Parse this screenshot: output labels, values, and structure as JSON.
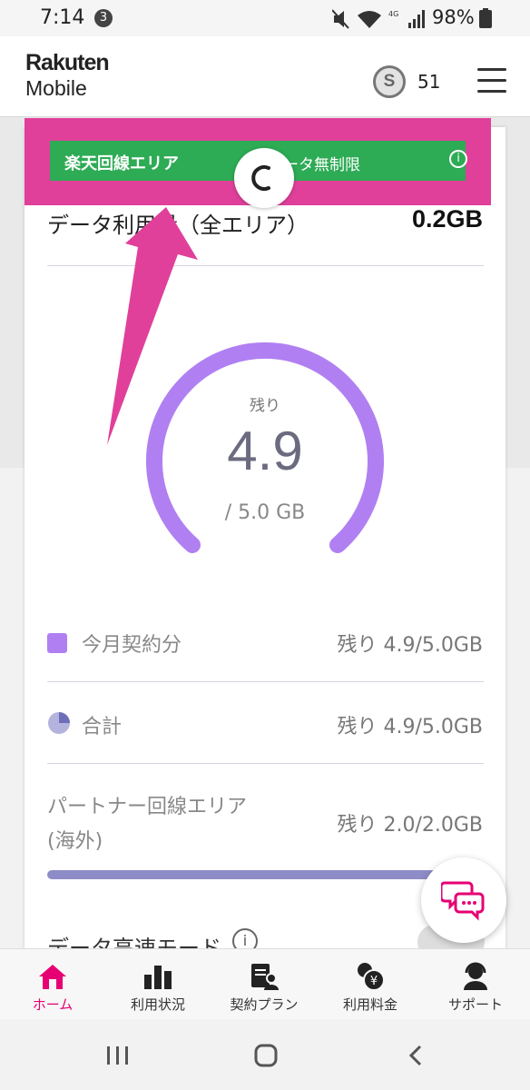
{
  "status_bar": {
    "time": "7:14",
    "notification_count": "3",
    "network": "4G",
    "battery": "98%"
  },
  "header": {
    "logo_line1": "Rakuten",
    "logo_line2": "Mobile",
    "points_icon_letter": "S",
    "points_count": "51"
  },
  "banner": {
    "area_label": "楽天回線エリア",
    "plan_label": "データ無制限",
    "highlight_color": "#e0409a",
    "banner_color": "#2dab55"
  },
  "usage": {
    "label": "データ利用量（全エリア）",
    "value": "0.2GB"
  },
  "gauge": {
    "remaining_label": "残り",
    "remaining_value": "4.9",
    "total": "/ 5.0 GB",
    "remaining_fraction": 0.98,
    "color": "#b080f2"
  },
  "breakdown": [
    {
      "label": "今月契約分",
      "value": "残り 4.9/5.0GB"
    },
    {
      "label": "合計",
      "value": "残り 4.9/5.0GB"
    },
    {
      "label_line1": "パートナー回線エリア",
      "label_line2": "(海外)",
      "value": "残り 2.0/2.0GB"
    }
  ],
  "fast_mode": {
    "label": "データ高速モード"
  },
  "bottom_nav": [
    {
      "label": "ホーム",
      "icon": "home-icon",
      "active": true
    },
    {
      "label": "利用状況",
      "icon": "bar-chart-icon"
    },
    {
      "label": "契約プラン",
      "icon": "contract-icon"
    },
    {
      "label": "利用料金",
      "icon": "yen-coins-icon"
    },
    {
      "label": "サポート",
      "icon": "support-agent-icon"
    }
  ],
  "accent_color": "#e60073"
}
